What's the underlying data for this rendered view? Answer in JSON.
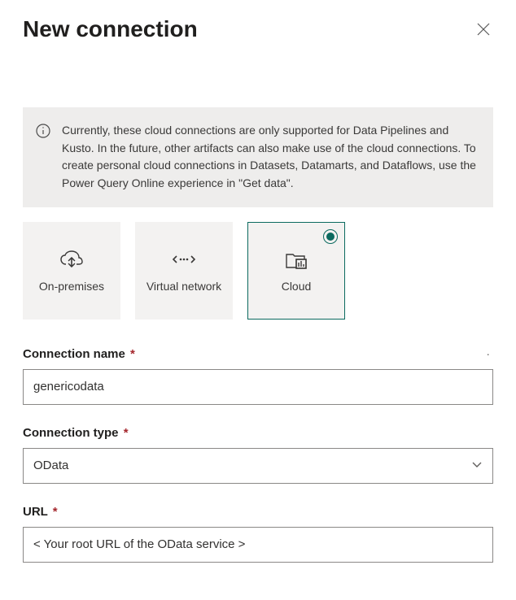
{
  "header": {
    "title": "New connection"
  },
  "info": {
    "text": "Currently, these cloud connections are only supported for Data Pipelines and Kusto. In the future, other artifacts can also make use of the cloud connections. To create personal cloud connections in Datasets, Datamarts, and Dataflows, use the Power Query Online experience in \"Get data\"."
  },
  "tiles": {
    "onprem": {
      "label": "On-premises"
    },
    "vnet": {
      "label": "Virtual network"
    },
    "cloud": {
      "label": "Cloud"
    }
  },
  "form": {
    "connectionName": {
      "label": "Connection name",
      "required": "*",
      "value": "genericodata"
    },
    "connectionType": {
      "label": "Connection type",
      "required": "*",
      "value": "OData"
    },
    "url": {
      "label": "URL",
      "required": "*",
      "value": "< Your root URL of the OData service >"
    }
  }
}
